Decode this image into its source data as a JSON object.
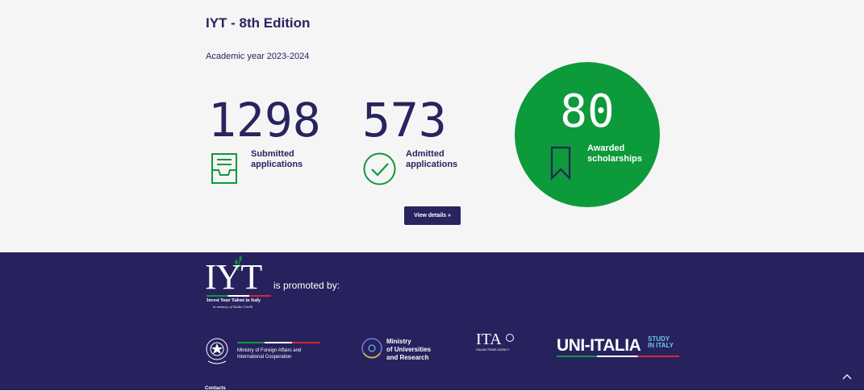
{
  "header": {
    "title": "IYT - 8th Edition",
    "academic_year": "Academic year 2023-2024"
  },
  "stats": {
    "submitted": {
      "value": "1298",
      "label": "Submitted applications",
      "icon": "inbox-tray-icon"
    },
    "admitted": {
      "value": "573",
      "label": "Admitted applications",
      "icon": "check-circle-icon"
    },
    "awarded": {
      "value": "80",
      "label": "Awarded scholarships",
      "icon": "bookmark-icon"
    }
  },
  "actions": {
    "view_details": "View details »"
  },
  "footer": {
    "logo_letters": "IYT",
    "logo_tagline": "Invest Your Talent in Italy",
    "logo_memorial": "in memory of Giulio Cirelli",
    "promoted_by": "is promoted by:",
    "partners": {
      "maeci": "Ministry of Foreign Affairs and International Cooperation",
      "mur_line1": "Ministry",
      "mur_line2": "of Universities",
      "mur_line3": "and Research",
      "ita_mark": "ITA",
      "ita_sub": "ITALIAN TRADE AGENCY",
      "uni_mark": "UNI-ITALIA",
      "uni_study": "STUDY",
      "uni_in_italy": "IN ITALY"
    },
    "contacts": "Contacts"
  },
  "colors": {
    "navy": "#27245f",
    "green": "#0d9a3a",
    "footer_bg": "#27215e",
    "page_bg": "#f5f5f5"
  }
}
